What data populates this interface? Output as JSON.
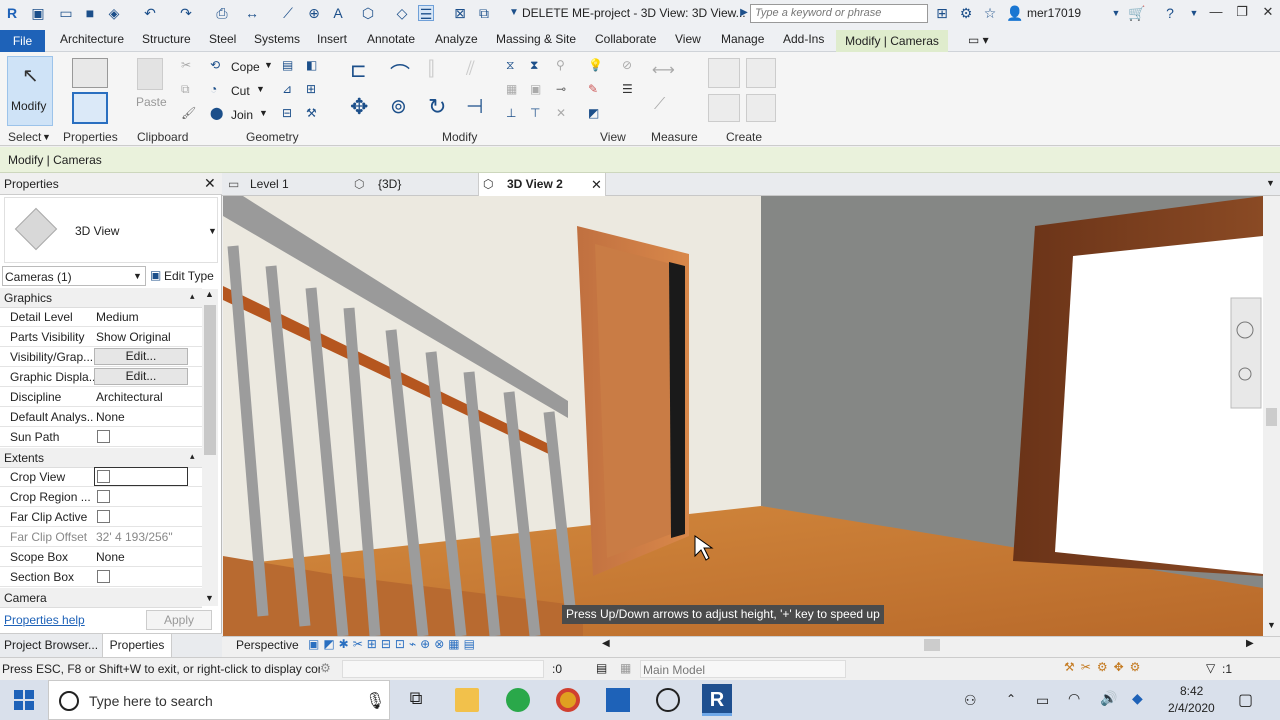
{
  "titlebar": {
    "app_initial": "R",
    "document_title": "DELETE ME-project - 3D View: 3D View...",
    "search_placeholder": "Type a keyword or phrase",
    "user": "mer17019"
  },
  "tabs": [
    "File",
    "Architecture",
    "Structure",
    "Steel",
    "Systems",
    "Insert",
    "Annotate",
    "Analyze",
    "Massing & Site",
    "Collaborate",
    "View",
    "Manage",
    "Add-Ins",
    "Modify | Cameras"
  ],
  "ribbon": {
    "modify_label": "Modify",
    "paste_label": "Paste",
    "cope_label": "Cope",
    "cut_label": "Cut",
    "join_label": "Join",
    "panels": [
      "Select",
      "Properties",
      "Clipboard",
      "Geometry",
      "Modify",
      "View",
      "Measure",
      "Create"
    ]
  },
  "context_bar": {
    "label": "Modify | Cameras"
  },
  "properties": {
    "title": "Properties",
    "type_name": "3D View",
    "filter": "Cameras (1)",
    "edit_type": "Edit Type",
    "groups": {
      "graphics": "Graphics",
      "extents": "Extents",
      "camera": "Camera"
    },
    "rows": {
      "detail_level": {
        "name": "Detail Level",
        "value": "Medium"
      },
      "parts_visibility": {
        "name": "Parts Visibility",
        "value": "Show Original"
      },
      "visibility_graphics": {
        "name": "Visibility/Grap...",
        "value": "Edit..."
      },
      "graphic_display": {
        "name": "Graphic Displa...",
        "value": "Edit..."
      },
      "discipline": {
        "name": "Discipline",
        "value": "Architectural"
      },
      "default_analysis": {
        "name": "Default Analys...",
        "value": "None"
      },
      "sun_path": {
        "name": "Sun Path",
        "value": ""
      },
      "crop_view": {
        "name": "Crop View",
        "value": ""
      },
      "crop_region": {
        "name": "Crop Region ...",
        "value": ""
      },
      "far_clip_active": {
        "name": "Far Clip Active",
        "value": ""
      },
      "far_clip_offset": {
        "name": "Far Clip Offset",
        "value": "32'  4 193/256\""
      },
      "scope_box": {
        "name": "Scope Box",
        "value": "None"
      },
      "section_box": {
        "name": "Section Box",
        "value": ""
      }
    },
    "help_link": "Properties help",
    "apply": "Apply",
    "bottom_tabs": [
      "Project Browser...",
      "Properties"
    ]
  },
  "view_tabs": [
    "Level 1",
    "{3D}",
    "3D View 2"
  ],
  "viewport": {
    "tooltip": "Press Up/Down arrows to adjust height, '+' key to speed up",
    "projection": "Perspective"
  },
  "statusbar": {
    "message": "Press ESC, F8 or Shift+W to exit, or right-click to display cor",
    "selection_count": ":0",
    "model": "Main Model",
    "filter_count": ":1"
  },
  "taskbar": {
    "search_placeholder": "Type here to search",
    "time": "8:42",
    "date": "2/4/2020"
  }
}
